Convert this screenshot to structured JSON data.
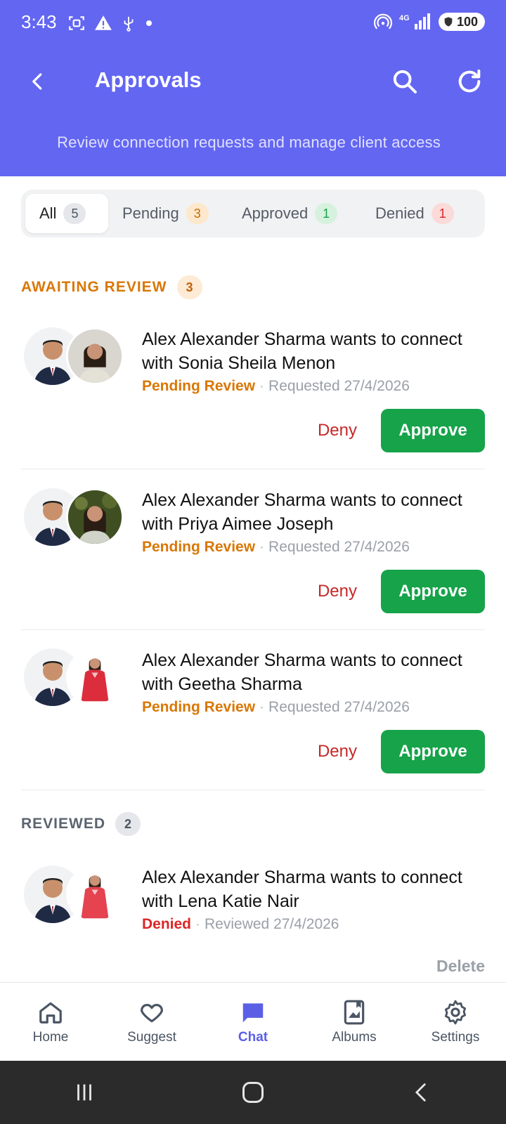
{
  "status_bar": {
    "time": "3:43",
    "battery": "100"
  },
  "header": {
    "title": "Approvals",
    "subtitle": "Review connection requests and manage client access",
    "colors": {
      "primary": "#6366f1"
    }
  },
  "tabs": [
    {
      "label": "All",
      "count": "5"
    },
    {
      "label": "Pending",
      "count": "3"
    },
    {
      "label": "Approved",
      "count": "1"
    },
    {
      "label": "Denied",
      "count": "1"
    }
  ],
  "awaiting": {
    "title": "AWAITING REVIEW",
    "count": "3",
    "requests": [
      {
        "title": "Alex Alexander Sharma wants to connect with Sonia Sheila Menon",
        "status": "Pending Review",
        "date": "Requested 27/4/2026",
        "deny": "Deny",
        "approve": "Approve"
      },
      {
        "title": "Alex Alexander Sharma wants to connect with Priya Aimee Joseph",
        "status": "Pending Review",
        "date": "Requested 27/4/2026",
        "deny": "Deny",
        "approve": "Approve"
      },
      {
        "title": "Alex Alexander Sharma wants to connect with Geetha Sharma",
        "status": "Pending Review",
        "date": "Requested 27/4/2026",
        "deny": "Deny",
        "approve": "Approve"
      }
    ]
  },
  "reviewed": {
    "title": "REVIEWED",
    "count": "2",
    "requests": [
      {
        "title": "Alex Alexander Sharma wants to connect with Lena Katie Nair",
        "status": "Denied",
        "date": "Reviewed 27/4/2026",
        "delete": "Delete"
      }
    ]
  },
  "bottom_nav": [
    {
      "label": "Home",
      "icon": "home-icon"
    },
    {
      "label": "Suggest",
      "icon": "heart-icon"
    },
    {
      "label": "Chat",
      "icon": "chat-icon",
      "active": true
    },
    {
      "label": "Albums",
      "icon": "album-icon"
    },
    {
      "label": "Settings",
      "icon": "gear-icon"
    }
  ]
}
